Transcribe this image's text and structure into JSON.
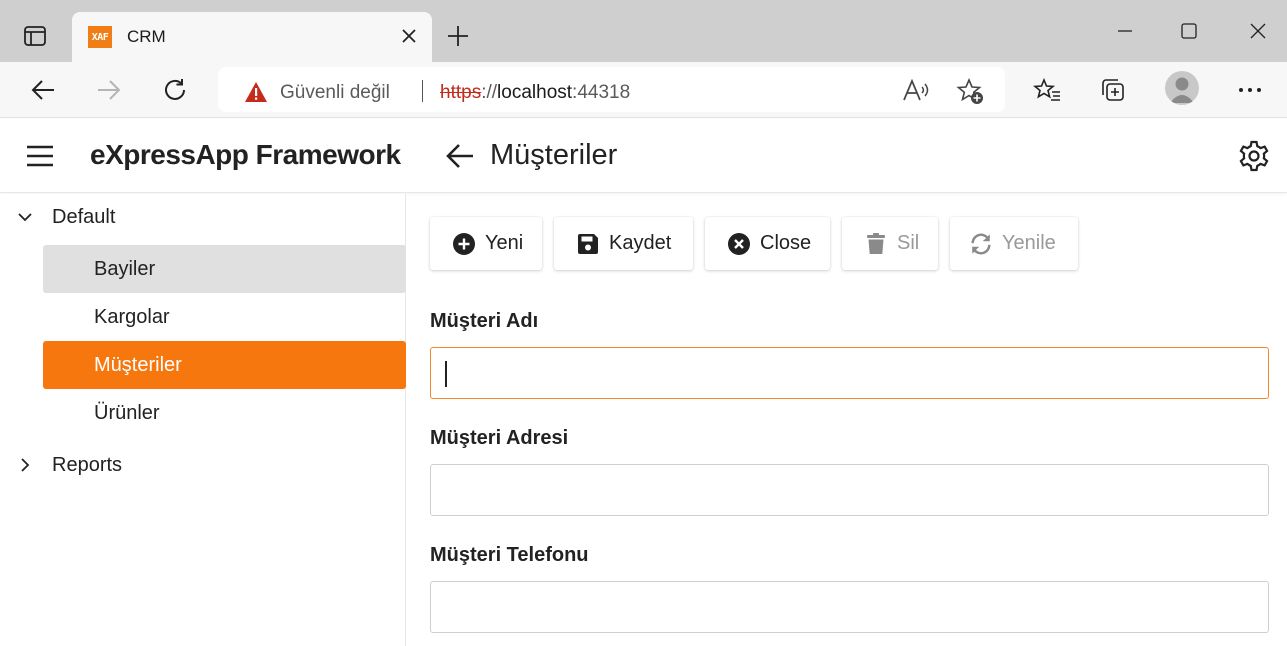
{
  "browser": {
    "tab": {
      "favicon_text": "XAF",
      "title": "CRM"
    },
    "address": {
      "security_text": "Güvenli değil",
      "url_scheme": "https",
      "url_separator": "://",
      "url_host": "localhost",
      "url_port": ":44318"
    },
    "icons": {
      "tab_actions": "tab-actions-icon",
      "close_tab": "close-icon",
      "new_tab": "plus-icon",
      "minimize": "minimize-icon",
      "maximize": "maximize-icon",
      "close_window": "close-icon",
      "back": "arrow-left-icon",
      "forward": "arrow-right-icon",
      "refresh": "refresh-icon",
      "warning": "warning-icon",
      "read_aloud": "read-aloud-icon",
      "add_favorite": "star-plus-icon",
      "favorites": "favorites-icon",
      "collections": "collections-icon",
      "profile": "profile-icon",
      "more": "more-icon"
    }
  },
  "app": {
    "title": "eXpressApp Framework",
    "view_title": "Müşteriler",
    "icons": {
      "menu": "hamburger-icon",
      "back": "arrow-left-icon",
      "settings": "gear-icon"
    }
  },
  "sidebar": {
    "groups": [
      {
        "label": "Default",
        "expanded": true,
        "items": [
          {
            "label": "Bayiler",
            "state": "hover"
          },
          {
            "label": "Kargolar",
            "state": "normal"
          },
          {
            "label": "Müşteriler",
            "state": "active"
          },
          {
            "label": "Ürünler",
            "state": "normal"
          }
        ]
      },
      {
        "label": "Reports",
        "expanded": false,
        "items": []
      }
    ]
  },
  "toolbar": {
    "buttons": [
      {
        "label": "Yeni",
        "icon": "plus-circle-icon",
        "enabled": true
      },
      {
        "label": "Kaydet",
        "icon": "save-icon",
        "enabled": true
      },
      {
        "label": "Close",
        "icon": "close-circle-icon",
        "enabled": true
      },
      {
        "label": "Sil",
        "icon": "trash-icon",
        "enabled": false
      },
      {
        "label": "Yenile",
        "icon": "refresh-icon",
        "enabled": false
      }
    ]
  },
  "form": {
    "fields": [
      {
        "label": "Müşteri Adı",
        "value": "",
        "focused": true
      },
      {
        "label": "Müşteri Adresi",
        "value": "",
        "focused": false
      },
      {
        "label": "Müşteri Telefonu",
        "value": "",
        "focused": false
      }
    ]
  },
  "colors": {
    "accent": "#f7770f",
    "focus_border": "#f08a2c",
    "warning": "#c42b1c",
    "hover_bg": "#e0e0e0"
  }
}
